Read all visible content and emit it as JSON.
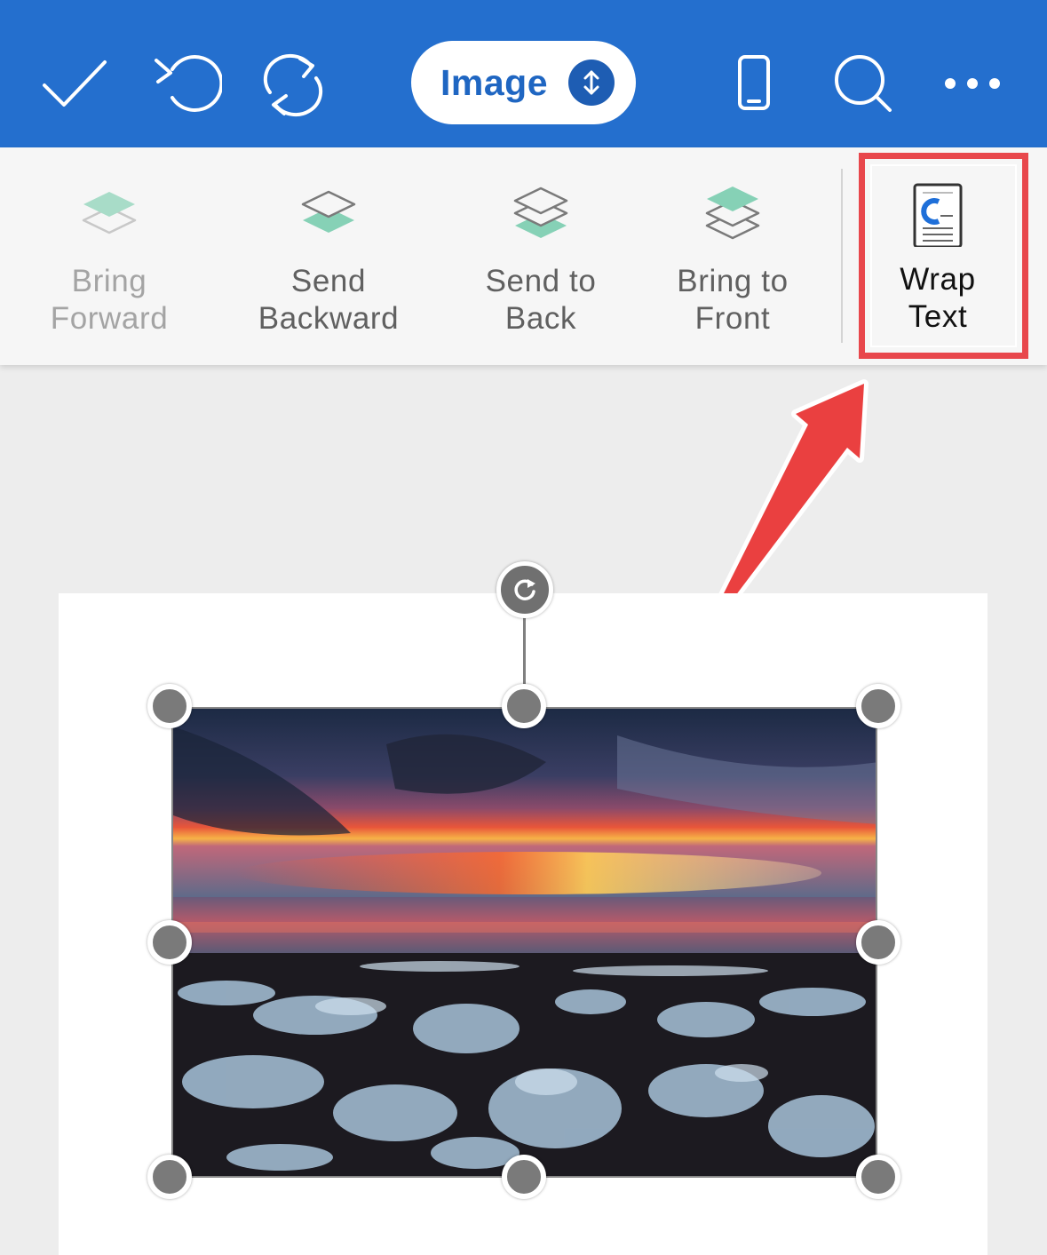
{
  "topbar": {
    "mode_label": "Image",
    "icons": [
      "checkmark-icon",
      "undo-icon",
      "redo-icon",
      "mobile-view-icon",
      "search-icon",
      "more-icon"
    ],
    "background": "#246fce"
  },
  "ribbon": {
    "items": [
      {
        "label_line1": "Bring",
        "label_line2": "Forward",
        "icon": "bring-forward-icon",
        "state": "disabled"
      },
      {
        "label_line1": "Send",
        "label_line2": "Backward",
        "icon": "send-backward-icon",
        "state": "enabled"
      },
      {
        "label_line1": "Send to",
        "label_line2": "Back",
        "icon": "send-to-back-icon",
        "state": "enabled"
      },
      {
        "label_line1": "Bring to",
        "label_line2": "Front",
        "icon": "bring-to-front-icon",
        "state": "enabled"
      },
      {
        "label_line1": "Wrap",
        "label_line2": "Text",
        "icon": "wrap-text-icon",
        "state": "highlighted"
      }
    ],
    "accent_green": "#86d1b6",
    "highlight_color": "#e8474c"
  },
  "document": {
    "image": "selected-photo",
    "handles": [
      "top-left",
      "top",
      "top-right",
      "left",
      "right",
      "bottom-left",
      "bottom",
      "bottom-right"
    ],
    "rotate_handle": "rotate-icon"
  }
}
